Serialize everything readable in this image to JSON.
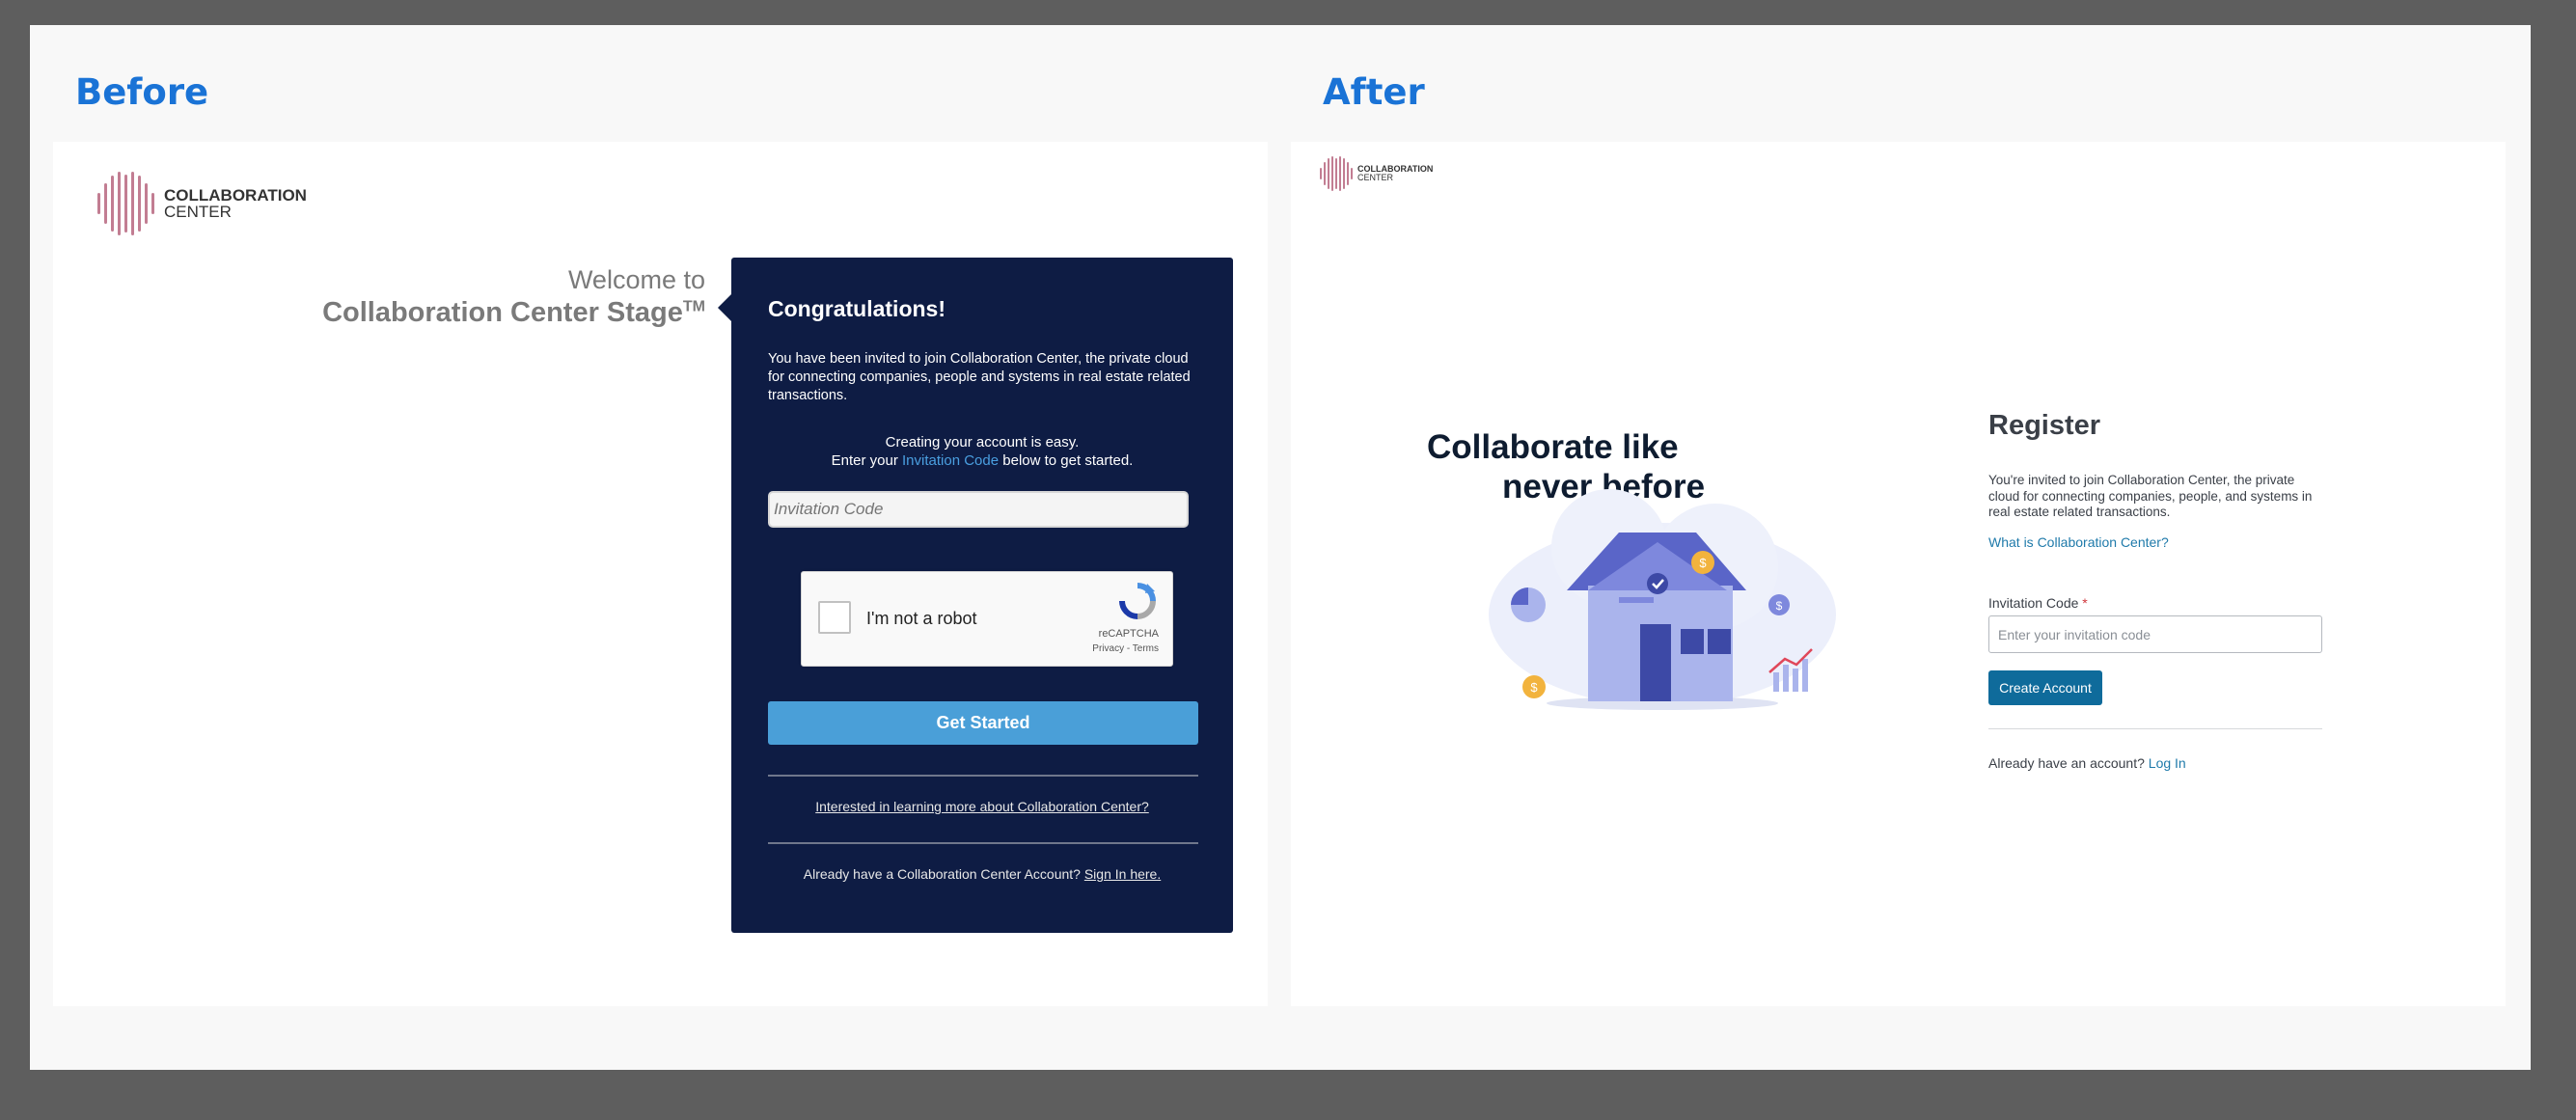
{
  "before": {
    "section_label": "Before",
    "logo": {
      "line1": "COLLABORATION",
      "line2": "CENTER"
    },
    "welcome_line1": "Welcome to",
    "welcome_line2": "Collaboration Center Stage",
    "trademark": "TM",
    "card": {
      "heading": "Congratulations!",
      "intro": "You have been invited to join Collaboration Center, the private cloud for connecting companies, people and systems in real estate related transactions.",
      "easy_line": "Creating your account is easy.",
      "enter_prefix": "Enter your ",
      "enter_link": "Invitation Code",
      "enter_suffix": " below to get started.",
      "invitation_placeholder": "Invitation Code",
      "recaptcha": {
        "label": "I'm not a robot",
        "brand": "reCAPTCHA",
        "terms": "Privacy - Terms"
      },
      "button": "Get Started",
      "learn_more": "Interested in learning more about Collaboration Center?",
      "already_prefix": "Already have a Collaboration Center Account? ",
      "already_link": "Sign In here."
    }
  },
  "after": {
    "section_label": "After",
    "logo": {
      "line1": "COLLABORATION",
      "line2": "CENTER"
    },
    "tagline_line1": "Collaborate like",
    "tagline_line2": "never before",
    "register": {
      "title": "Register",
      "description": "You're invited to join Collaboration Center, the private cloud for connecting companies, people, and systems in real estate related transactions.",
      "what_link": "What is Collaboration Center?",
      "field_label": "Invitation Code",
      "required_mark": "*",
      "field_placeholder": "Enter your invitation code",
      "button": "Create Account",
      "have_account_prefix": "Already have an account? ",
      "login_link": "Log In"
    }
  },
  "colors": {
    "accent_blue": "#1a73d6",
    "card_navy": "#0e1c44",
    "get_started_button": "#4a9fd8",
    "create_account_button": "#0f6b9b",
    "logo_pink": "#c27d92"
  }
}
